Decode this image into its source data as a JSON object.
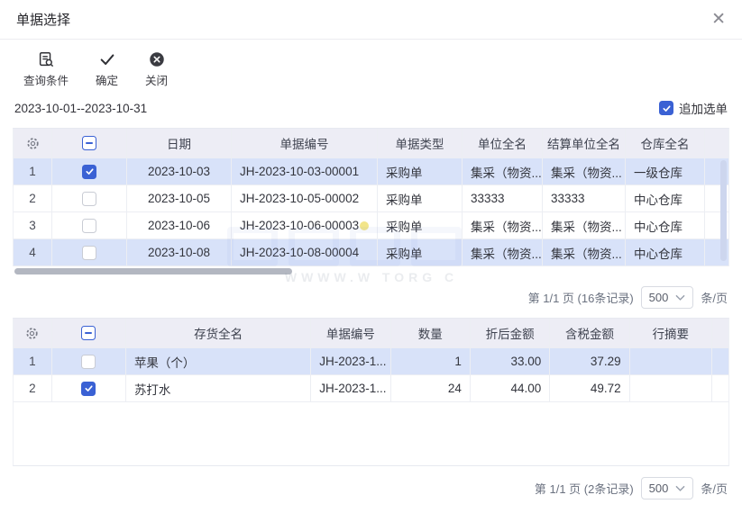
{
  "dialog": {
    "title": "单据选择",
    "close_glyph": "✕"
  },
  "toolbar": [
    {
      "label": "查询条件",
      "icon": "query-conditions-icon"
    },
    {
      "label": "确定",
      "icon": "confirm-check-icon"
    },
    {
      "label": "关闭",
      "icon": "close-circle-icon"
    }
  ],
  "filter": {
    "date_range": "2023-10-01--2023-10-31",
    "append_label": "追加选单",
    "append_checked": true
  },
  "colors": {
    "accent": "#3a61d4",
    "row_selected": "#d8e2f9",
    "header_bg": "#ededf5",
    "dot": "#f2e58a"
  },
  "doc_table": {
    "columns": [
      "日期",
      "单据编号",
      "单据类型",
      "单位全名",
      "结算单位全名",
      "仓库全名"
    ],
    "rows": [
      {
        "num": "1",
        "checked": true,
        "selected": true,
        "dot": false,
        "cells": [
          "2023-10-03",
          "JH-2023-10-03-00001",
          "采购单",
          "集采（物资...",
          "集采（物资...",
          "一级仓库"
        ]
      },
      {
        "num": "2",
        "checked": false,
        "selected": false,
        "dot": false,
        "cells": [
          "2023-10-05",
          "JH-2023-10-05-00002",
          "采购单",
          "33333",
          "33333",
          "中心仓库"
        ]
      },
      {
        "num": "3",
        "checked": false,
        "selected": false,
        "dot": true,
        "cells": [
          "2023-10-06",
          "JH-2023-10-06-00003",
          "采购单",
          "集采（物资...",
          "集采（物资...",
          "中心仓库"
        ]
      },
      {
        "num": "4",
        "checked": false,
        "selected": true,
        "dot": false,
        "cells": [
          "2023-10-08",
          "JH-2023-10-08-00004",
          "采购单",
          "集采（物资...",
          "集采（物资...",
          "中心仓库"
        ]
      }
    ],
    "pagination": {
      "page_info": "第 1/1 页 (16条记录)",
      "page_size": "500",
      "unit": "条/页"
    }
  },
  "item_table": {
    "columns": [
      "存货全名",
      "单据编号",
      "数量",
      "折后金额",
      "含税金额",
      "行摘要"
    ],
    "rows": [
      {
        "num": "1",
        "checked": false,
        "selected": true,
        "dot": false,
        "cells": [
          "苹果（个）",
          "JH-2023-1...",
          "1",
          "33.00",
          "37.29",
          ""
        ]
      },
      {
        "num": "2",
        "checked": true,
        "selected": false,
        "dot": false,
        "cells": [
          "苏打水",
          "JH-2023-1...",
          "24",
          "44.00",
          "49.72",
          ""
        ]
      }
    ],
    "pagination": {
      "page_info": "第 1/1 页 (2条记录)",
      "page_size": "500",
      "unit": "条/页"
    }
  },
  "watermark": {
    "text": "WWWW.W TORG C"
  }
}
